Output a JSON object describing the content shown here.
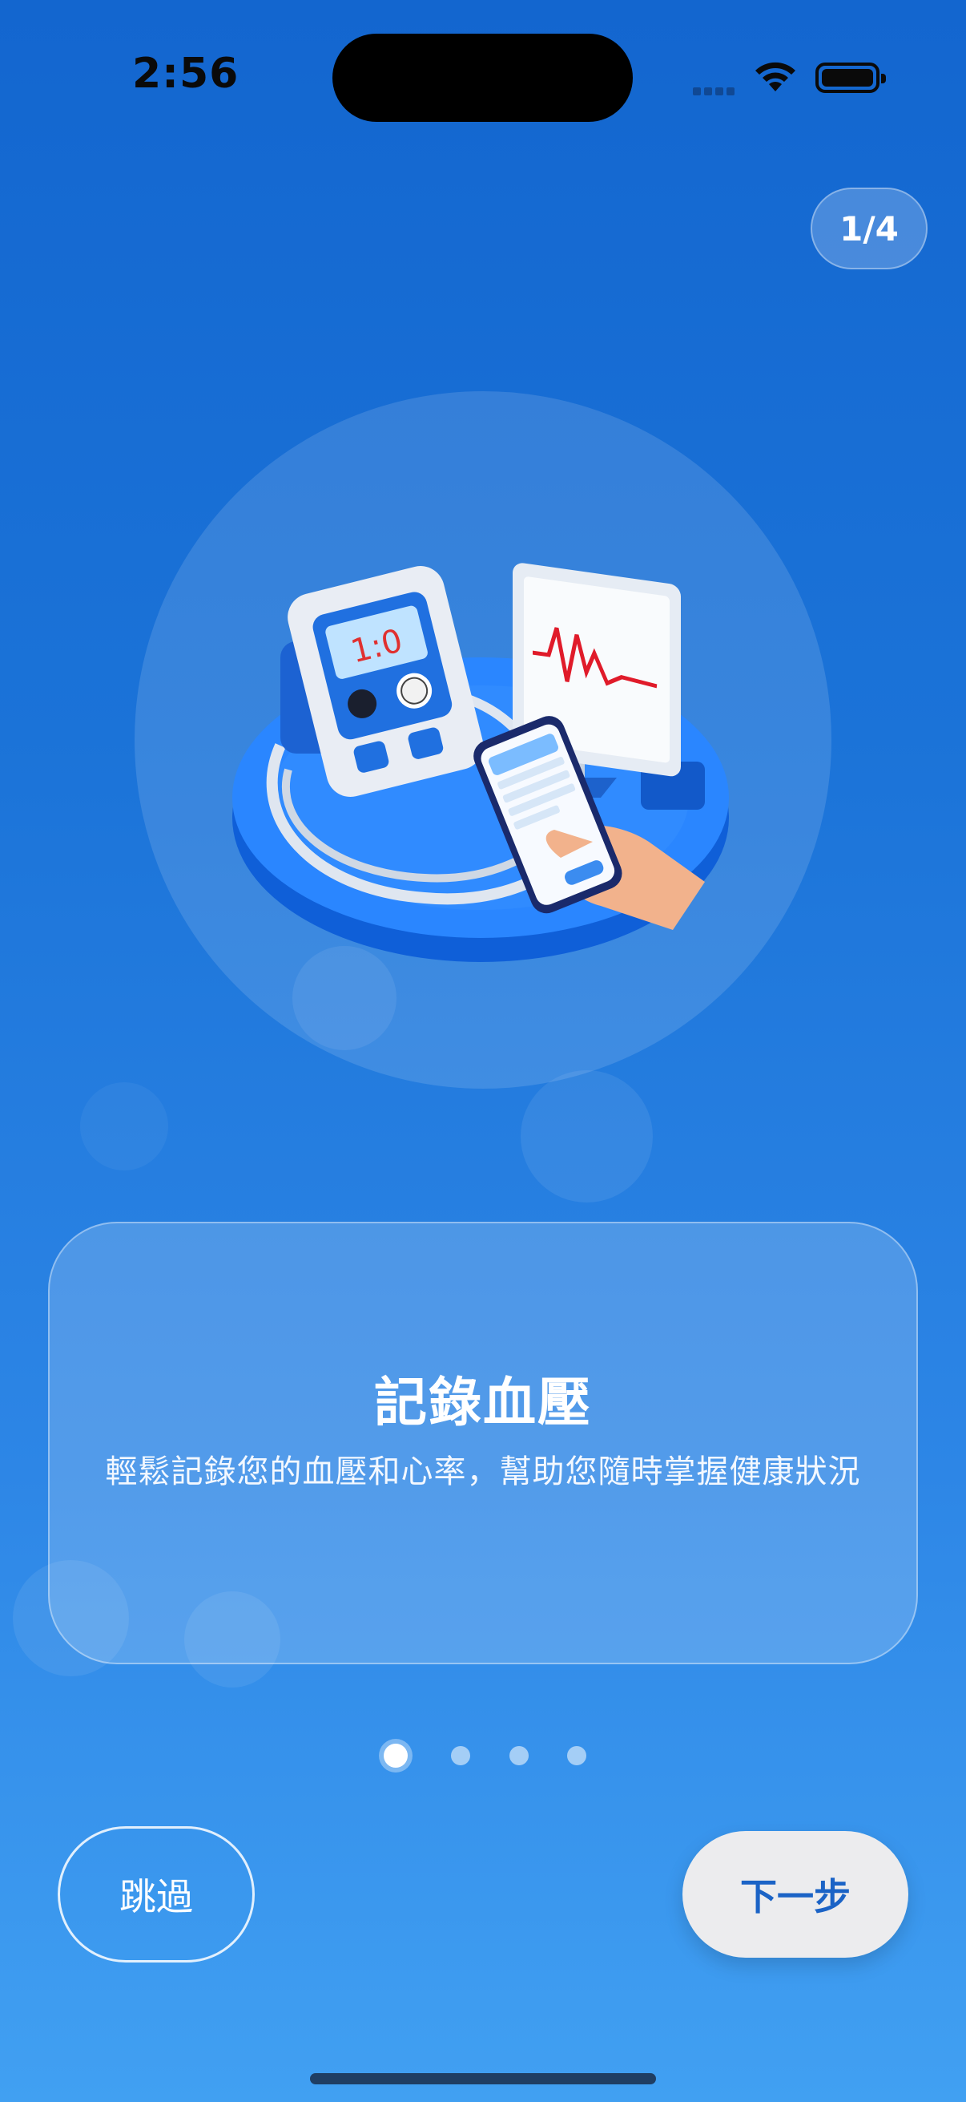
{
  "status_bar": {
    "time": "2:56"
  },
  "header": {
    "page_counter": "1/4"
  },
  "card": {
    "title": "記錄血壓",
    "description": "輕鬆記錄您的血壓和心率，幫助您隨時掌握健康狀況"
  },
  "illustration": {
    "monitor_reading": "1:0"
  },
  "pagination": {
    "total": 4,
    "active_index": 0
  },
  "actions": {
    "skip_label": "跳過",
    "next_label": "下一步"
  },
  "colors": {
    "accent": "#1b63c6",
    "background_top": "#1366cf",
    "background_bottom": "#41a0f2"
  }
}
